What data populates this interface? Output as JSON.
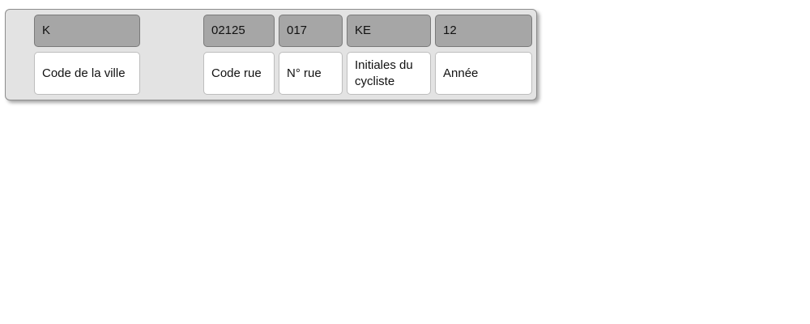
{
  "fields": [
    {
      "code": "K",
      "label": "Code de la ville"
    },
    {
      "code": "02125",
      "label": "Code rue"
    },
    {
      "code": "017",
      "label": "N° rue"
    },
    {
      "code": "KE",
      "label": "Initiales du cycliste"
    },
    {
      "code": "12",
      "label": "Année"
    }
  ],
  "colors": {
    "code_box": "#a6a6a6",
    "label_box": "#ffffff",
    "panel": "#e3e3e3"
  }
}
